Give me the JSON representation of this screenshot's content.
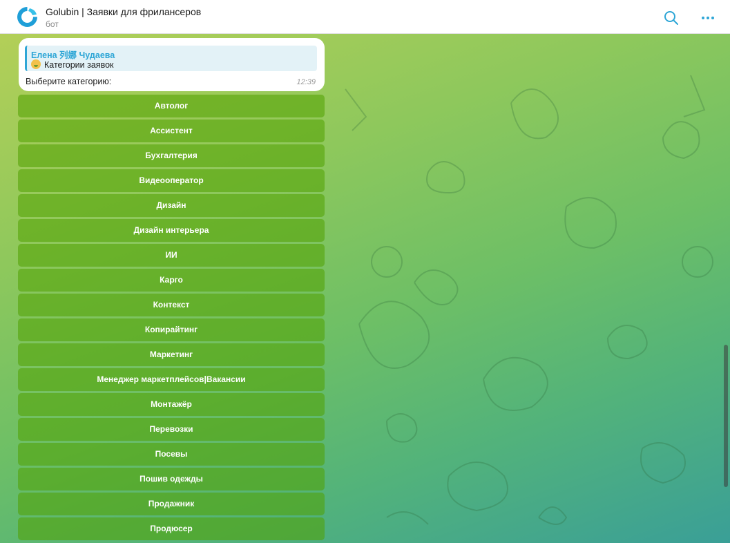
{
  "header": {
    "title": "Golubin | Заявки для фрилансеров",
    "subtitle": "бот",
    "avatar_icon": "golubin-logo",
    "search_icon": "search-icon",
    "menu_icon": "more-icon",
    "accent": "#2ea6d6"
  },
  "message": {
    "reply": {
      "name": "Елена 列娜 Чудаева",
      "emoji_icon": "face-emoji",
      "text": "Категории заявок"
    },
    "text": "Выберите категорию:",
    "time": "12:39"
  },
  "keyboard": {
    "buttons": [
      "Автолог",
      "Ассистент",
      "Бухгалтерия",
      "Видеооператор",
      "Дизайн",
      "Дизайн интерьера",
      "ИИ",
      "Карго",
      "Контекст",
      "Копирайтинг",
      "Маркетинг",
      "Менеджер маркетплейсов|Вакансии",
      "Монтажёр",
      "Перевозки",
      "Посевы",
      "Пошив одежды",
      "Продажник",
      "Продюсер"
    ]
  }
}
